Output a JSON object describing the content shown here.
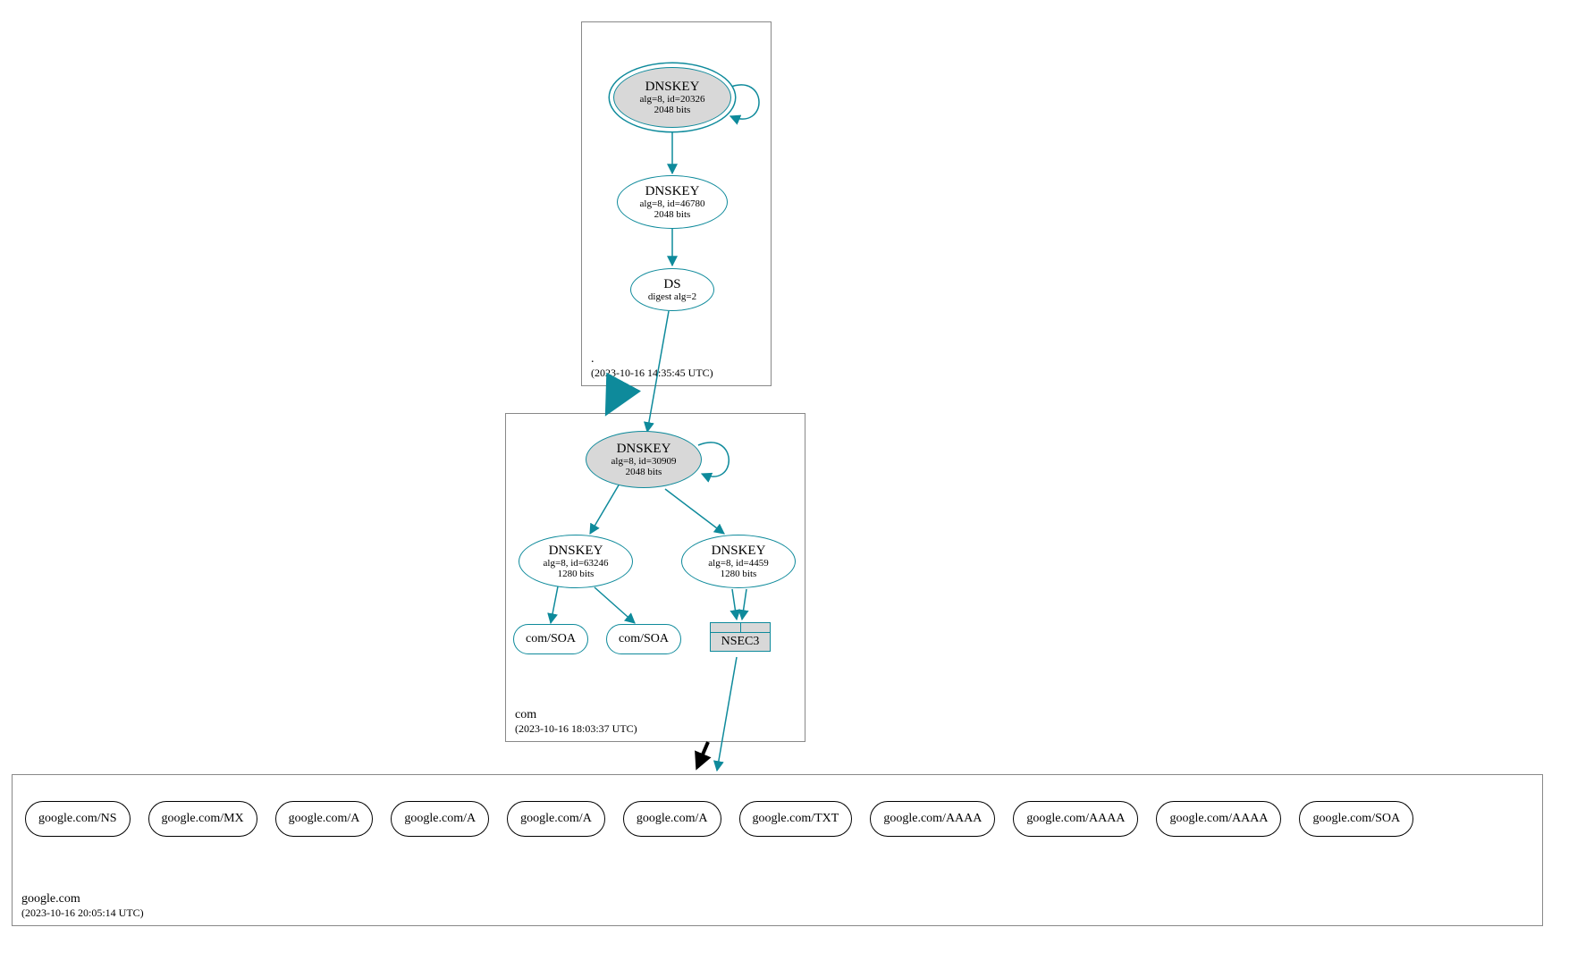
{
  "colors": {
    "teal": "#0e8a9b",
    "nodeFill": "#d8d8d8",
    "border": "#888888"
  },
  "zones": {
    "root": {
      "name": ".",
      "timestamp": "(2023-10-16 14:35:45 UTC)"
    },
    "com": {
      "name": "com",
      "timestamp": "(2023-10-16 18:03:37 UTC)"
    },
    "google": {
      "name": "google.com",
      "timestamp": "(2023-10-16 20:05:14 UTC)"
    }
  },
  "nodes": {
    "root_ksk": {
      "title": "DNSKEY",
      "line1": "alg=8, id=20326",
      "line2": "2048 bits"
    },
    "root_zsk": {
      "title": "DNSKEY",
      "line1": "alg=8, id=46780",
      "line2": "2048 bits"
    },
    "root_ds": {
      "title": "DS",
      "line1": "digest alg=2"
    },
    "com_ksk": {
      "title": "DNSKEY",
      "line1": "alg=8, id=30909",
      "line2": "2048 bits"
    },
    "com_zsk1": {
      "title": "DNSKEY",
      "line1": "alg=8, id=63246",
      "line2": "1280 bits"
    },
    "com_zsk2": {
      "title": "DNSKEY",
      "line1": "alg=8, id=4459",
      "line2": "1280 bits"
    },
    "com_soa1": {
      "label": "com/SOA"
    },
    "com_soa2": {
      "label": "com/SOA"
    },
    "nsec3": {
      "label": "NSEC3"
    }
  },
  "records": [
    "google.com/NS",
    "google.com/MX",
    "google.com/A",
    "google.com/A",
    "google.com/A",
    "google.com/A",
    "google.com/TXT",
    "google.com/AAAA",
    "google.com/AAAA",
    "google.com/AAAA",
    "google.com/SOA"
  ]
}
